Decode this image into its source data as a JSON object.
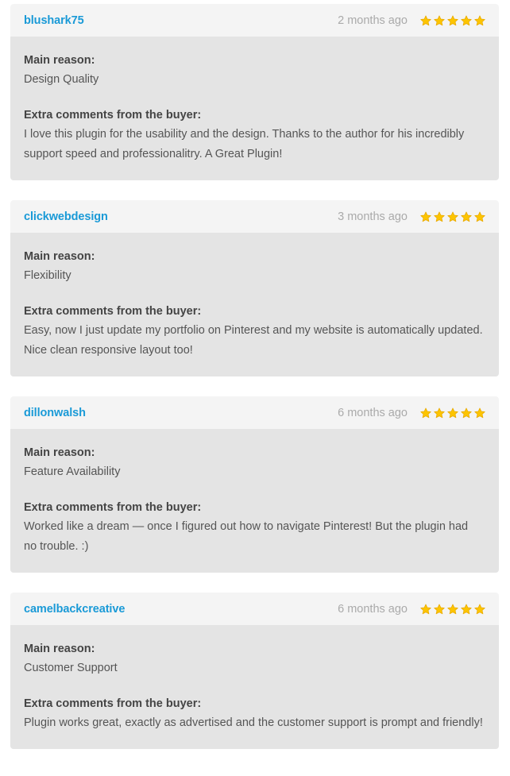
{
  "labels": {
    "main_reason": "Main reason:",
    "extra_comments": "Extra comments from the buyer:"
  },
  "colors": {
    "page_background": "#ffffff",
    "card_header_background": "#f4f4f4",
    "card_body_background": "#e4e4e4",
    "author_link": "#1a9ad7",
    "date_text": "#aaaaaa",
    "label_text": "#444444",
    "value_text": "#555555",
    "star_fill": "#fdc500",
    "star_outline": "#e8a900"
  },
  "icons": {
    "star": "star-icon"
  },
  "reviews": [
    {
      "author": "blushark75",
      "date": "2 months ago",
      "rating": 5,
      "rating_max": 5,
      "main_reason": "Design Quality",
      "comment": "I love this plugin for the usability and the design. Thanks to the author for his incredibly support speed and professionalitry. A Great Plugin!"
    },
    {
      "author": "clickwebdesign",
      "date": "3 months ago",
      "rating": 5,
      "rating_max": 5,
      "main_reason": "Flexibility",
      "comment": "Easy, now I just update my portfolio on Pinterest and my website is automatically updated. Nice clean responsive layout too!"
    },
    {
      "author": "dillonwalsh",
      "date": "6 months ago",
      "rating": 5,
      "rating_max": 5,
      "main_reason": "Feature Availability",
      "comment": "Worked like a dream — once I figured out how to navigate Pinterest! But the plugin had no trouble. :)"
    },
    {
      "author": "camelbackcreative",
      "date": "6 months ago",
      "rating": 5,
      "rating_max": 5,
      "main_reason": "Customer Support",
      "comment": "Plugin works great, exactly as advertised and the customer support is prompt and friendly!"
    }
  ]
}
